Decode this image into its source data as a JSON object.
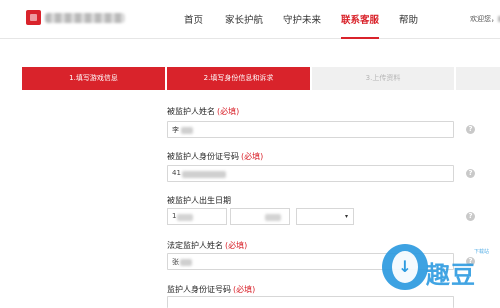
{
  "header": {
    "nav": [
      {
        "label": "首页",
        "active": false
      },
      {
        "label": "家长护航",
        "active": false
      },
      {
        "label": "守护未来",
        "active": false
      },
      {
        "label": "联系客服",
        "active": true
      },
      {
        "label": "帮助",
        "active": false
      }
    ],
    "welcome": "欢迎您，"
  },
  "steps": [
    {
      "label": "1.填写游戏信息",
      "state": "done"
    },
    {
      "label": "2.填写身份信息和诉求",
      "state": "current"
    },
    {
      "label": "3.上传资料",
      "state": "todo"
    }
  ],
  "form": {
    "required_mark": "(必填)",
    "ward_name": {
      "label": "被监护人姓名",
      "value": "李"
    },
    "ward_id": {
      "label": "被监护人身份证号码",
      "value": "41"
    },
    "ward_birth": {
      "label": "被监护人出生日期",
      "year": "1",
      "caret": "▾"
    },
    "guardian_name": {
      "label": "法定监护人姓名",
      "value": "张"
    },
    "guardian_id": {
      "label": "监护人身份证号码"
    }
  },
  "help_icon_text": "?",
  "watermark": {
    "text": "趣豆",
    "small": "下载站",
    "arrow": "↓"
  }
}
